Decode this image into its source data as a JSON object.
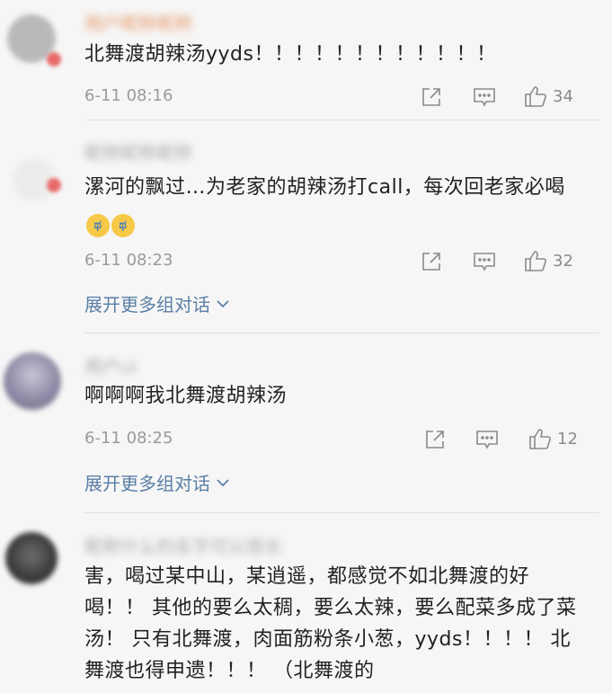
{
  "comments": [
    {
      "username": "用户昵称昵称",
      "text": "北舞渡胡辣汤yyds！！！！！！！！！！！！",
      "time": "6-11 08:16",
      "likes": "34"
    },
    {
      "username": "昵称昵称昵称",
      "text": "漯河的飘过…为老家的胡辣汤打call，每次回老家必喝",
      "time": "6-11 08:23",
      "likes": "32",
      "expand": "展开更多组对话"
    },
    {
      "username": "用户ui",
      "text": "啊啊啊我北舞渡胡辣汤",
      "time": "6-11 08:25",
      "likes": "12",
      "expand": "展开更多组对话"
    },
    {
      "username": "昵称什么的名字可以很长",
      "text": "害，喝过某中山，某逍遥，都感觉不如北舞渡的好喝！！ 其他的要么太稠，要么太辣，要么配菜多成了菜汤！ 只有北舞渡，肉面筋粉条小葱，yyds！！！！ 北舞渡也得申遗！！！ （北舞渡的"
    }
  ],
  "icons": {
    "share": "share-icon",
    "reply": "comment-icon",
    "like": "thumbs-up-icon",
    "expand": "chevron-down-icon",
    "emoji": "crying-face-icon"
  },
  "colors": {
    "link": "#5a7fa6",
    "meta": "#9a9a9a",
    "text": "#222222",
    "background": "#f6f6f6"
  }
}
